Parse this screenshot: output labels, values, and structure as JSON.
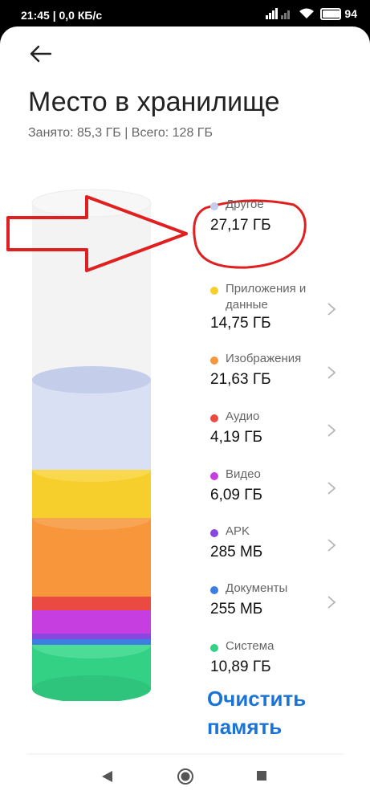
{
  "status_bar": {
    "time_speed": "21:45 | 0,0 КБ/с",
    "battery": "94"
  },
  "header": {
    "title": "Место в хранилище",
    "subtitle": "Занято: 85,3 ГБ | Всего: 128 ГБ"
  },
  "legend": [
    {
      "name": "Другое",
      "size": "27,17 ГБ",
      "color": "#c4cde9",
      "chevron": false
    },
    {
      "name": "Приложения и данные",
      "size": "14,75 ГБ",
      "color": "#f7cf2c",
      "chevron": true
    },
    {
      "name": "Изображения",
      "size": "21,63 ГБ",
      "color": "#f7963a",
      "chevron": true
    },
    {
      "name": "Аудио",
      "size": "4,19 ГБ",
      "color": "#ea4a42",
      "chevron": true
    },
    {
      "name": "Видео",
      "size": "6,09 ГБ",
      "color": "#c63de0",
      "chevron": true
    },
    {
      "name": "APK",
      "size": "285 МБ",
      "color": "#8747e0",
      "chevron": true
    },
    {
      "name": "Документы",
      "size": "255 МБ",
      "color": "#3b7fe0",
      "chevron": true
    },
    {
      "name": "Система",
      "size": "10,89 ГБ",
      "color": "#33d184",
      "chevron": false
    }
  ],
  "actions": {
    "clear_label": "Очистить память"
  },
  "colors": {
    "accent": "#1a74d8",
    "callout": "#e02020"
  },
  "icons": {
    "back": "arrow-left-icon",
    "chevron": "chevron-right-icon",
    "nav_back": "triangle-back-icon",
    "nav_home": "circle-home-icon",
    "nav_recents": "square-recents-icon"
  }
}
